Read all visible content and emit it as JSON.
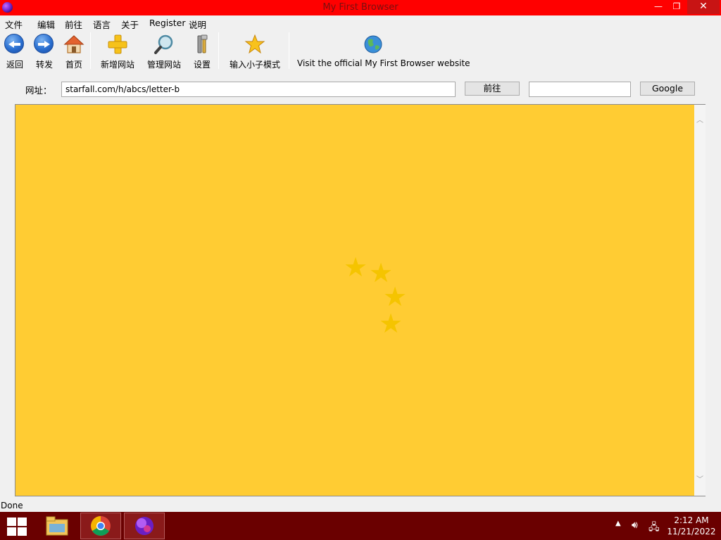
{
  "window": {
    "title": "My First Browser",
    "controls": {
      "minimize": "—",
      "maximize": "❐",
      "close": "✕"
    }
  },
  "menu": [
    "文件",
    "编辑",
    "前往",
    "语言",
    "关于",
    "Register",
    "说明"
  ],
  "toolbar": {
    "back": "返回",
    "forward": "转发",
    "home": "首页",
    "add_site": "新增网站",
    "manage_sites": "管理网站",
    "settings": "设置",
    "kid_mode": "输入小子模式",
    "official_site": "Visit the official My First Browser website"
  },
  "address": {
    "label": "网址：",
    "url": "starfall.com/h/abcs/letter-b",
    "go_button": "前往",
    "search_value": "",
    "search_button": "Google"
  },
  "page": {
    "background": "#ffcc33",
    "loading_stars": 4
  },
  "status": {
    "text": "Done"
  },
  "taskbar": {
    "time": "2:12 AM",
    "date": "11/21/2022"
  },
  "colors": {
    "titlebar": "#ff0000",
    "taskbar": "#6a0000",
    "page": "#ffcc33"
  }
}
